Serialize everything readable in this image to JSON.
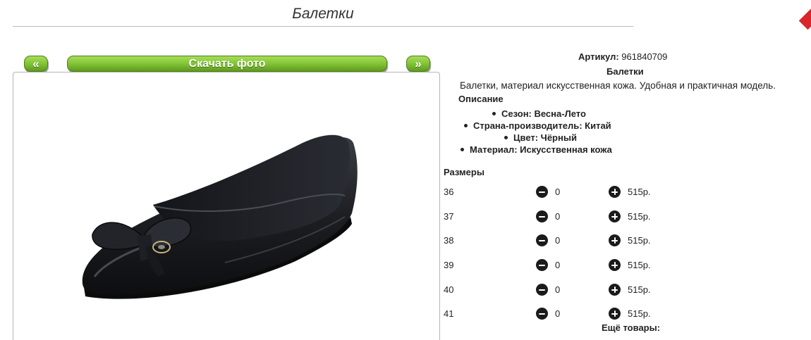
{
  "page": {
    "title": "Балетки"
  },
  "gallery": {
    "prev_label": "«",
    "download_label": "Скачать фото",
    "next_label": "»"
  },
  "product": {
    "article_label": "Артикул:",
    "article_value": "961840709",
    "name": "Балетки",
    "summary": "Балетки, материал искусственная кожа. Удобная и практичная модель.",
    "description_heading": "Описание",
    "specs": [
      "Сезон: Весна-Лето",
      "Страна-производитель: Китай",
      "Цвет: Чёрный",
      "Материал: Искусственная кожа"
    ]
  },
  "sizes": {
    "heading": "Размеры",
    "rows": [
      {
        "size": "36",
        "qty": "0",
        "price": "515р."
      },
      {
        "size": "37",
        "qty": "0",
        "price": "515р."
      },
      {
        "size": "38",
        "qty": "0",
        "price": "515р."
      },
      {
        "size": "39",
        "qty": "0",
        "price": "515р."
      },
      {
        "size": "40",
        "qty": "0",
        "price": "515р."
      },
      {
        "size": "41",
        "qty": "0",
        "price": "515р."
      }
    ]
  },
  "more": {
    "heading": "Ещё товары:"
  },
  "icons": {
    "decrement": "minus-circle-icon",
    "increment": "plus-circle-icon"
  },
  "colors": {
    "button_green": "#86c73a",
    "icon_dark": "#1b1b1b"
  }
}
